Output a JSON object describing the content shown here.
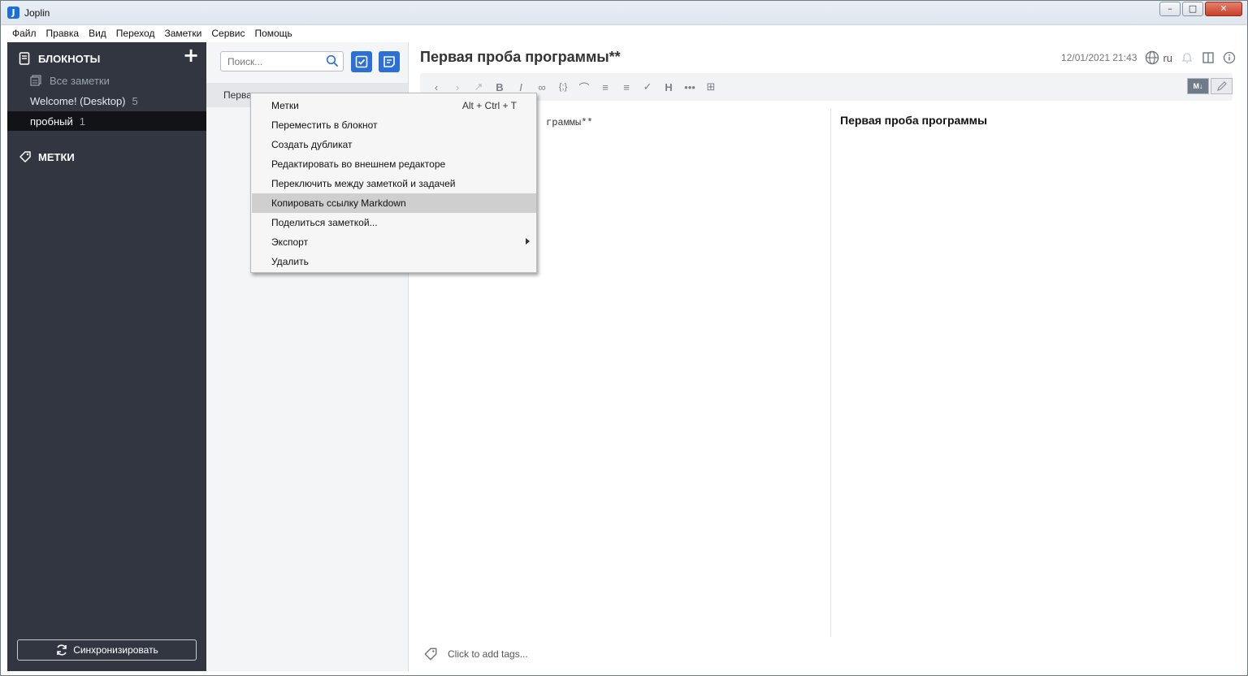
{
  "window": {
    "title": "Joplin",
    "icon_letter": "J",
    "minimize": "–",
    "maximize": "□",
    "close": "✕"
  },
  "menubar": [
    "Файл",
    "Правка",
    "Вид",
    "Переход",
    "Заметки",
    "Сервис",
    "Помощь"
  ],
  "sidebar": {
    "notebooks_header": "БЛОКНОТЫ",
    "add_label": "+",
    "all_notes": "Все заметки",
    "items": [
      {
        "label": "Welcome! (Desktop)",
        "count": "5"
      },
      {
        "label": "пробный",
        "count": "1"
      }
    ],
    "tags_header": "МЕТКИ",
    "sync_button": "Синхронизировать"
  },
  "notelist": {
    "search_placeholder": "Поиск...",
    "note_title_truncated": "Перва"
  },
  "editor": {
    "title": "Первая проба программы**",
    "date": "12/01/2021 21:43",
    "language": "ru",
    "markdown_text": "граммы**",
    "preview_title": "Первая проба программы",
    "tags_placeholder": "Click to add tags...",
    "md_toggle": "M↓"
  },
  "context_menu": {
    "items": [
      {
        "label": "Метки",
        "shortcut": "Alt + Ctrl + T"
      },
      {
        "label": "Переместить в блокнот"
      },
      {
        "label": "Создать дубликат"
      },
      {
        "label": "Редактировать во внешнем редакторе"
      },
      {
        "label": "Переключить между заметкой и задачей"
      },
      {
        "label": "Копировать ссылку Markdown",
        "hovered": true
      },
      {
        "label": "Поделиться заметкой..."
      },
      {
        "label": "Экспорт",
        "submenu": true
      },
      {
        "label": "Удалить"
      }
    ]
  },
  "colors": {
    "sidebar_bg": "#313640",
    "accent": "#2c6fd6",
    "selected_bg": "#111317"
  }
}
